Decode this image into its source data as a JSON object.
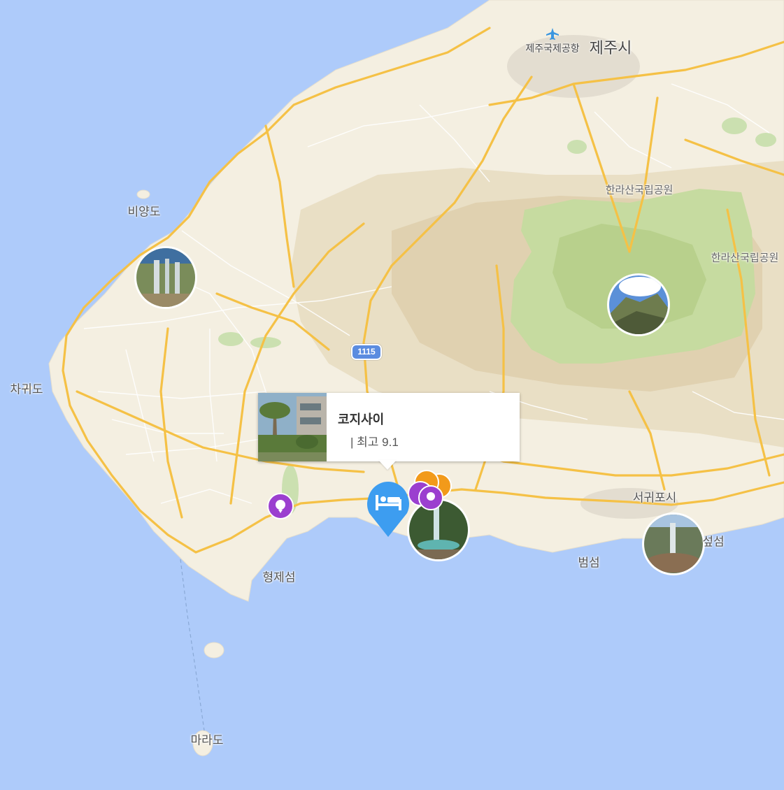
{
  "map": {
    "labels": {
      "jeju_city": "제주시",
      "airport": "제주국제공항",
      "hallasan_park_1": "한라산국립공원",
      "hallasan_park_2": "한라산국립공원",
      "biyangdo": "비양도",
      "chagwido": "차귀도",
      "seogwipo": "서귀포시",
      "beomseom": "범섬",
      "hyeongjeseom": "형제섬",
      "marado": "마라도",
      "seom_partial": "섶섬"
    },
    "road_shield": "1115",
    "colors": {
      "water": "#aecbfa",
      "land": "#f4efe1",
      "road_major": "#f5c146",
      "park": "#c8dca0",
      "highland": "#e7dcc0",
      "hotel_pin": "#3d9df0",
      "poi_purple": "#9b3fcf",
      "poi_orange": "#f29a1a"
    }
  },
  "popup": {
    "title": "코지사이",
    "subtitle": "| 최고 9.1"
  },
  "markers": {
    "hotel_icon": "bed-icon",
    "poi_icon": "balloon-icon"
  }
}
